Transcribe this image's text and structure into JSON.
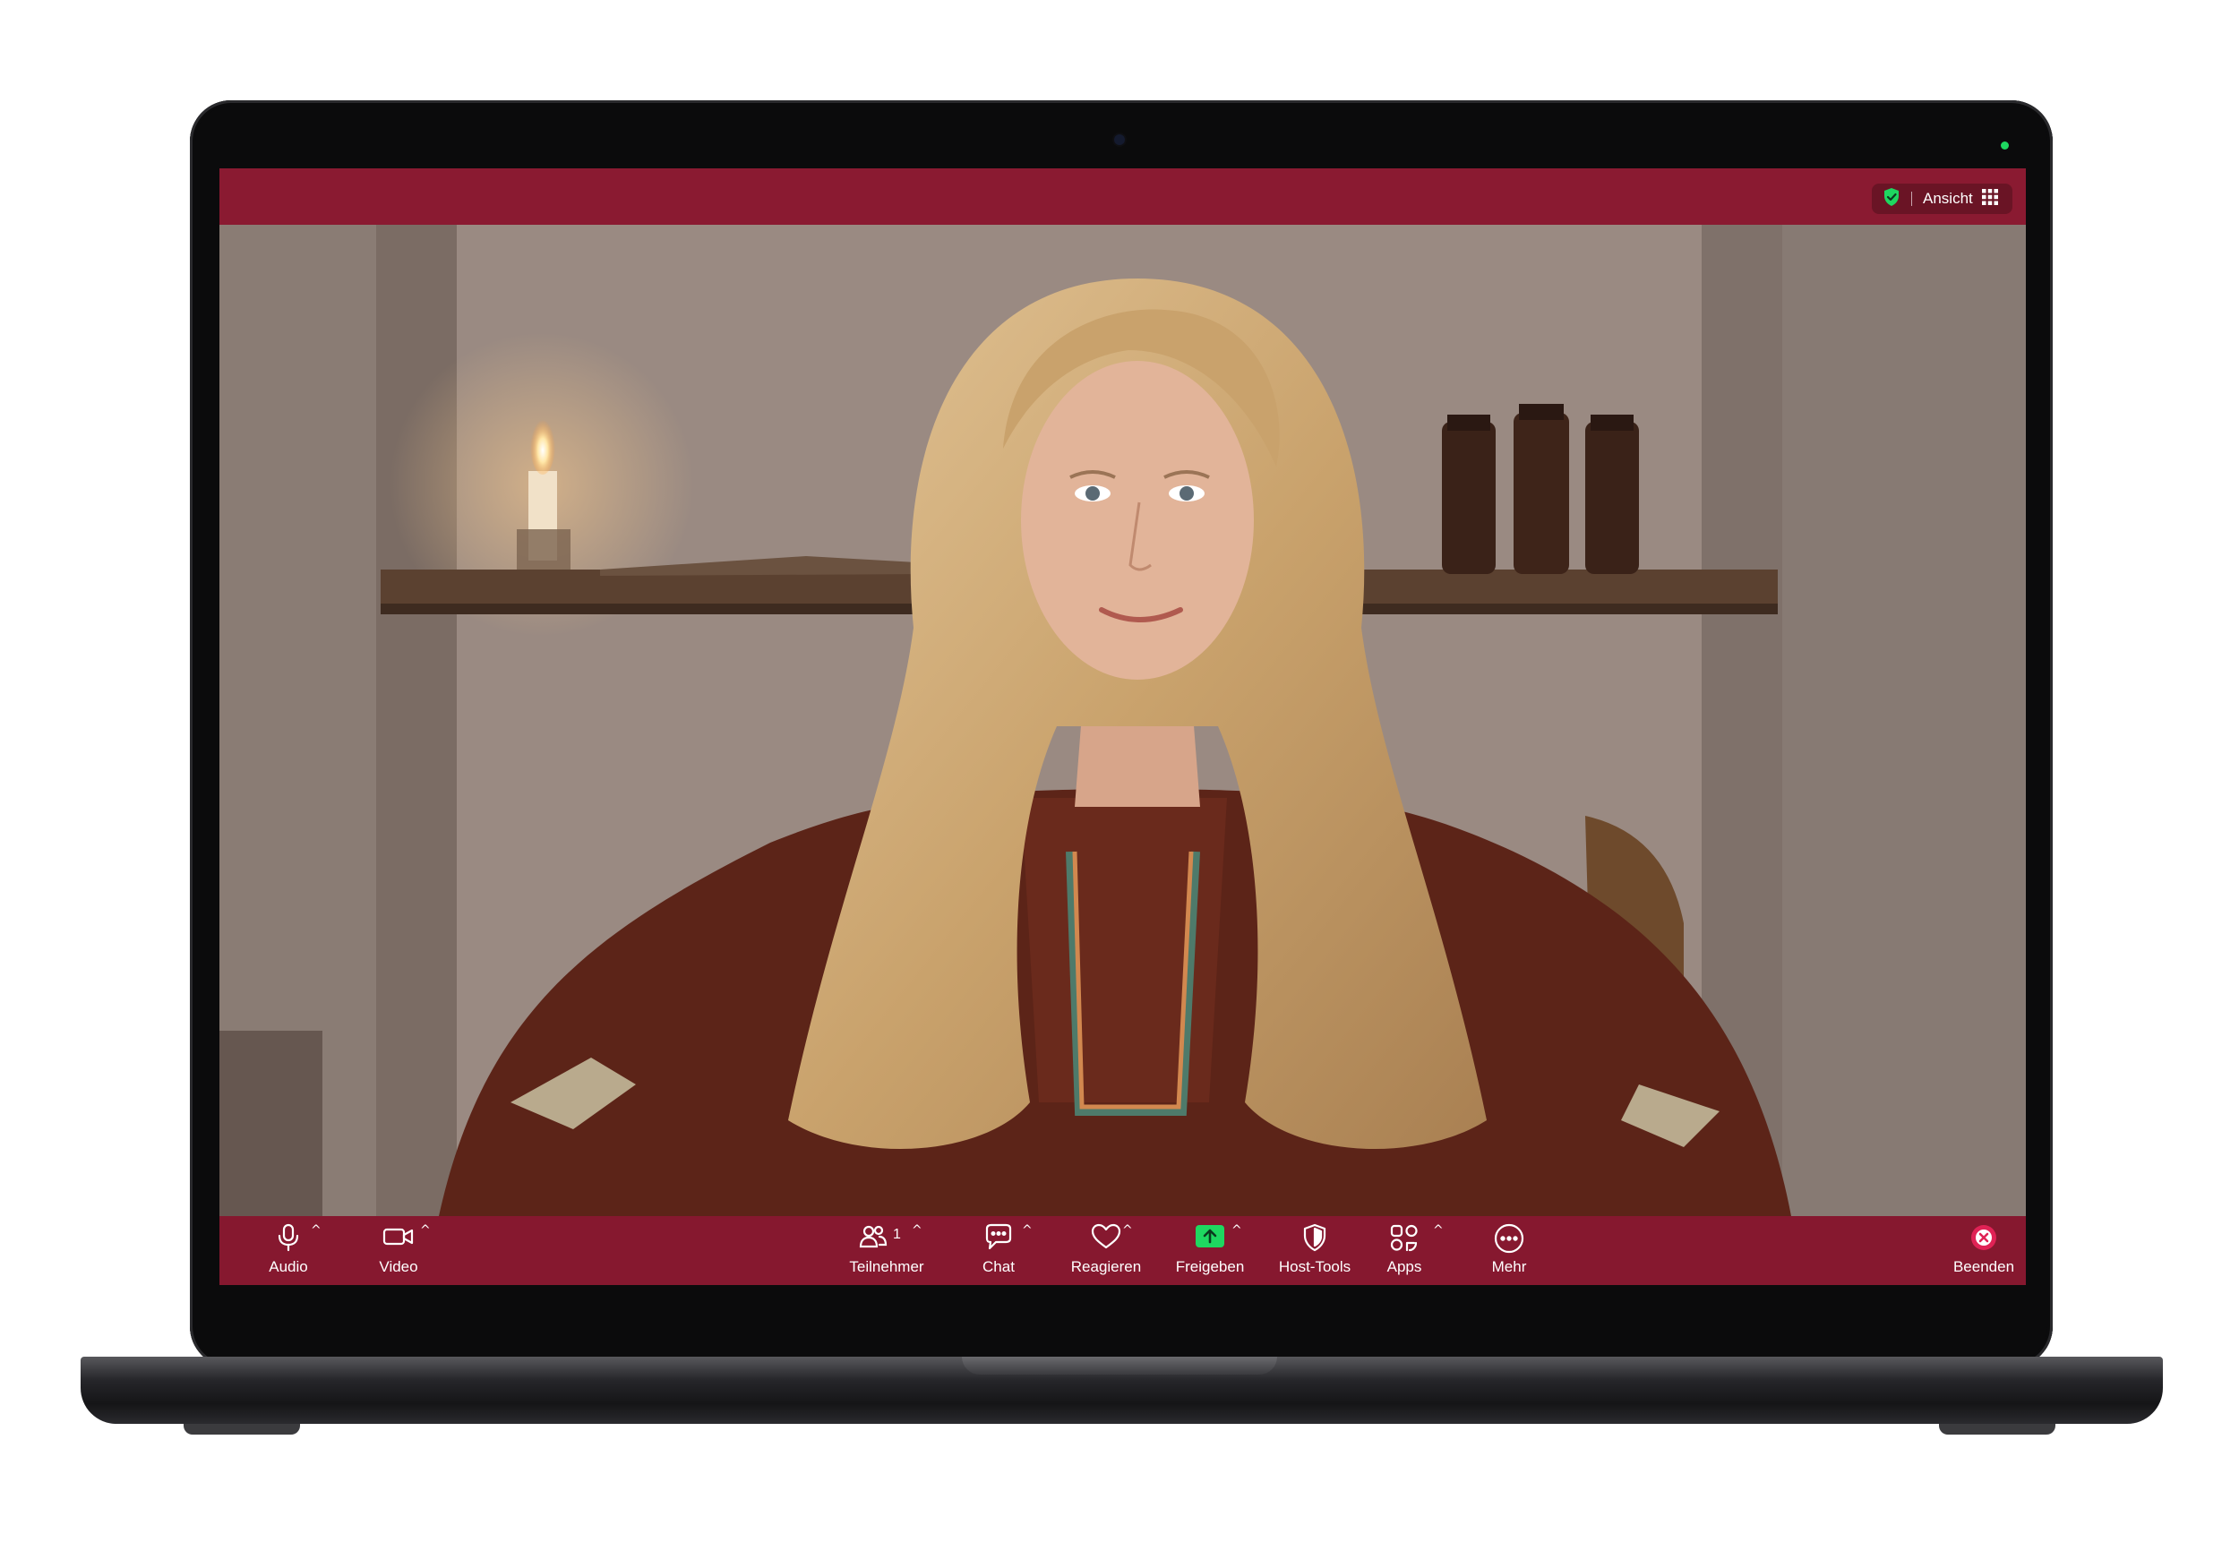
{
  "topbar": {
    "view_label": "Ansicht",
    "security_icon": "shield-check-icon",
    "view_icon": "grid-icon",
    "accent_color": "#1ed760"
  },
  "toolbar": {
    "audio": {
      "label": "Audio",
      "icon": "microphone-icon"
    },
    "video": {
      "label": "Video",
      "icon": "video-camera-icon"
    },
    "participants": {
      "label": "Teilnehmer",
      "count": "1",
      "icon": "participants-icon"
    },
    "chat": {
      "label": "Chat",
      "icon": "chat-bubble-icon"
    },
    "react": {
      "label": "Reagieren",
      "icon": "heart-icon"
    },
    "share": {
      "label": "Freigeben",
      "icon": "share-screen-icon",
      "color": "#1ed760"
    },
    "host_tools": {
      "label": "Host-Tools",
      "icon": "shield-icon"
    },
    "apps": {
      "label": "Apps",
      "icon": "apps-icon"
    },
    "more": {
      "label": "Mehr",
      "icon": "more-icon"
    },
    "end": {
      "label": "Beenden",
      "icon": "end-call-icon",
      "color": "#e02255"
    },
    "caret": "^"
  },
  "colors": {
    "frame": "#8a1a31",
    "toolbar": "#86182f"
  }
}
